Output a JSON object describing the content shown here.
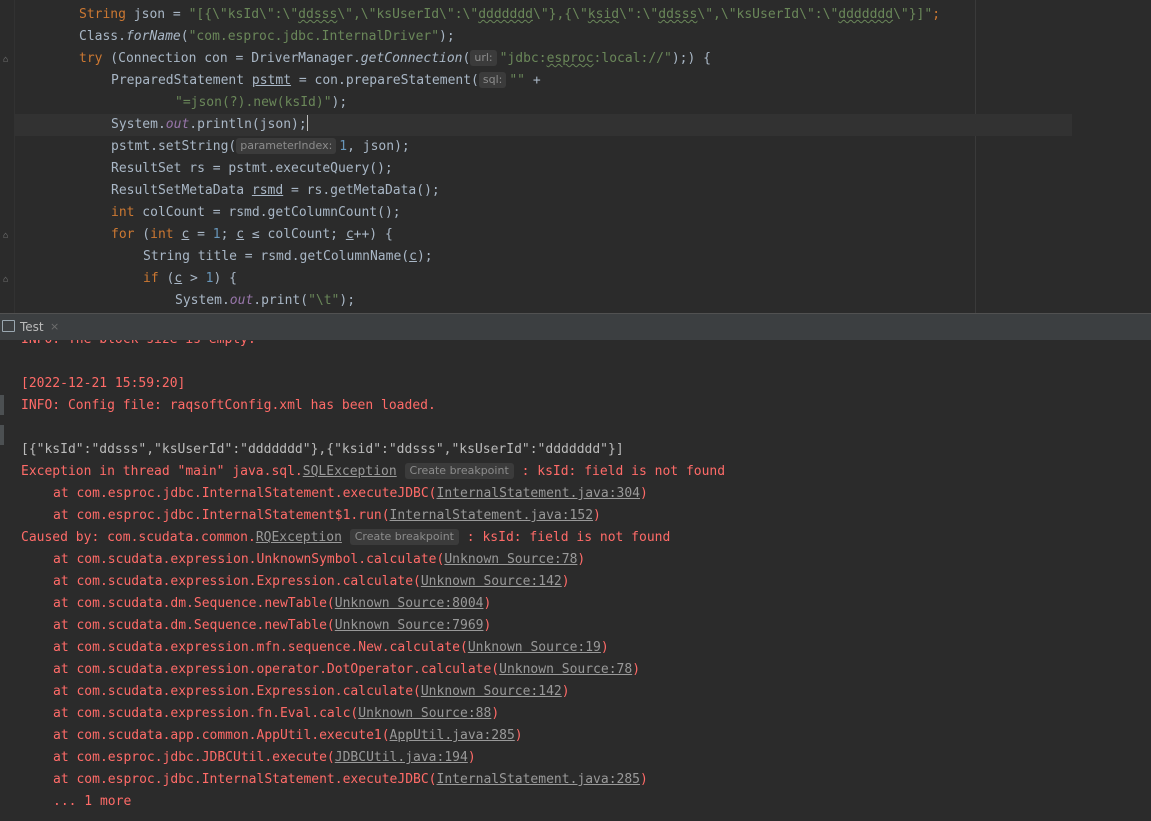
{
  "editor": {
    "lines": {
      "l1": {
        "kw": "String",
        "a": " json = ",
        "s1": "\"[{\\\"ksId\\\":\\\"",
        "w1": "ddsss",
        "s2": "\\\",\\\"ksUserId\\\":\\\"",
        "w2": "ddddddd",
        "s3": "\\\"},{\\\"",
        "w3": "ksid",
        "s4": "\\\":\\\"",
        "w4": "ddsss",
        "s5": "\\\",\\\"ksUserId\\\":\\\"",
        "w5": "ddddddd",
        "s6": "\\\"}]\"",
        "end": ";"
      },
      "l2": {
        "a": "Class.",
        "m": "forName",
        "b": "(",
        "s": "\"com.esproc.jdbc.InternalDriver\"",
        "c": ");"
      },
      "l3": {
        "kw": "try",
        "a": " (Connection con = DriverManager.",
        "m": "getConnection",
        "b": "(",
        "hint": "url:",
        "s1": "\"jdbc:",
        "w": "esproc",
        "s2": ":local://\"",
        "c": ");) {"
      },
      "l4": {
        "a": "PreparedStatement ",
        "u": "pstmt",
        "b": " = con.prepareStatement(",
        "hint": "sql:",
        "s": "\"\"",
        "c": " +"
      },
      "l5": {
        "s": "\"=json(?).new(ksId)\"",
        "c": ");"
      },
      "l6": {
        "a": "System.",
        "f": "out",
        "b": ".println(json);"
      },
      "l7": {
        "a": "pstmt.setString(",
        "hint": "parameterIndex:",
        "n": "1",
        "b": ", json);"
      },
      "l8": {
        "a": "ResultSet rs = pstmt.executeQuery();"
      },
      "l9": {
        "a": "ResultSetMetaData ",
        "u": "rsmd",
        "b": " = rs.getMetaData();"
      },
      "l10": {
        "kw": "int",
        "a": " colCount = rsmd.getColumnCount();"
      },
      "l11": {
        "kw": "for",
        "a": " (",
        "kw2": "int",
        "u1": "c",
        "b": " = ",
        "n": "1",
        "c": "; ",
        "u2": "c",
        "d": " ≤ colCount; ",
        "u3": "c",
        "e": "++) {"
      },
      "l12": {
        "a": "String title = rsmd.getColumnName(",
        "u": "c",
        "b": ");"
      },
      "l13": {
        "kw": "if",
        "a": " (",
        "u": "c",
        "b": " > ",
        "n": "1",
        "c": ") {"
      },
      "l14": {
        "a": "System.",
        "f": "out",
        "b": ".print(",
        "s": "\"\\t\"",
        "c": ");"
      }
    }
  },
  "tool_window": {
    "title": "Test",
    "close_glyph": "×"
  },
  "console": {
    "partial_line": "INFO: The block size is empty.",
    "timestamp": "[2022-12-21 15:59:20]",
    "config_loaded": "INFO: Config file: raqsoftConfig.xml has been loaded.",
    "json_out": "[{\"ksId\":\"ddsss\",\"ksUserId\":\"ddddddd\"},{\"ksid\":\"ddsss\",\"ksUserId\":\"ddddddd\"}]",
    "exception": {
      "prefix": "Exception in thread \"main\" java.sql.",
      "class_link": "SQLException",
      "breakpoint": "Create breakpoint",
      "message": " : ksId: field is not found"
    },
    "trace1": [
      {
        "at": "at com.esproc.jdbc.InternalStatement.executeJDBC(",
        "link": "InternalStatement.java:304",
        "close": ")"
      },
      {
        "at": "at com.esproc.jdbc.InternalStatement$1.run(",
        "link": "InternalStatement.java:152",
        "close": ")"
      }
    ],
    "caused_by": {
      "prefix": "Caused by: com.scudata.common.",
      "class_link": "RQException",
      "breakpoint": "Create breakpoint",
      "message": " : ksId: field is not found"
    },
    "trace2": [
      {
        "at": "at com.scudata.expression.UnknownSymbol.calculate(",
        "link": "Unknown Source:78",
        "close": ")"
      },
      {
        "at": "at com.scudata.expression.Expression.calculate(",
        "link": "Unknown Source:142",
        "close": ")"
      },
      {
        "at": "at com.scudata.dm.Sequence.newTable(",
        "link": "Unknown Source:8004",
        "close": ")"
      },
      {
        "at": "at com.scudata.dm.Sequence.newTable(",
        "link": "Unknown Source:7969",
        "close": ")"
      },
      {
        "at": "at com.scudata.expression.mfn.sequence.New.calculate(",
        "link": "Unknown Source:19",
        "close": ")"
      },
      {
        "at": "at com.scudata.expression.operator.DotOperator.calculate(",
        "link": "Unknown Source:78",
        "close": ")"
      },
      {
        "at": "at com.scudata.expression.Expression.calculate(",
        "link": "Unknown Source:142",
        "close": ")"
      },
      {
        "at": "at com.scudata.expression.fn.Eval.calc(",
        "link": "Unknown Source:88",
        "close": ")"
      },
      {
        "at": "at com.scudata.app.common.AppUtil.execute1(",
        "link": "AppUtil.java:285",
        "close": ")"
      },
      {
        "at": "at com.esproc.jdbc.JDBCUtil.execute(",
        "link": "JDBCUtil.java:194",
        "close": ")"
      },
      {
        "at": "at com.esproc.jdbc.InternalStatement.executeJDBC(",
        "link": "InternalStatement.java:285",
        "close": ")"
      }
    ],
    "more": "... 1 more"
  }
}
